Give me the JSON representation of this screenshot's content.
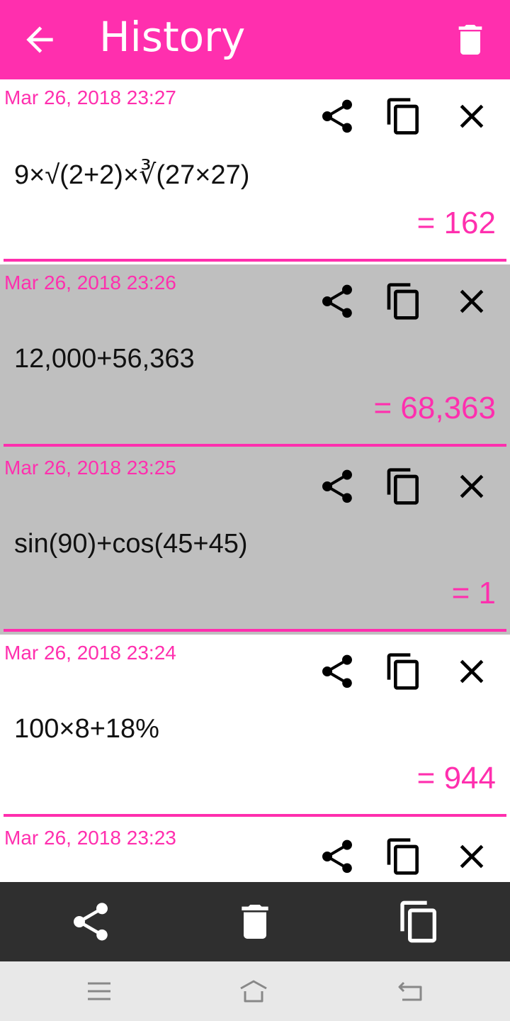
{
  "header": {
    "title": "History",
    "back_icon": "arrow-back-icon",
    "delete_icon": "trash-icon"
  },
  "colors": {
    "accent": "#ff2fae",
    "selected_row": "#bfbfbf",
    "bottom_bar": "#2f2f2f",
    "nav_bar": "#e8e8e8"
  },
  "history": [
    {
      "date": "Mar 26, 2018  23:27",
      "expression": "9×√(2+2)×∛(27×27)",
      "result": "= 162",
      "selected": false
    },
    {
      "date": "Mar 26, 2018  23:26",
      "expression": "12,000+56,363",
      "result": "= 68,363",
      "selected": true
    },
    {
      "date": "Mar 26, 2018  23:25",
      "expression": "sin(90)+cos(45+45)",
      "result": "= 1",
      "selected": true
    },
    {
      "date": "Mar 26, 2018  23:24",
      "expression": "100×8+18%",
      "result": "= 944",
      "selected": false
    },
    {
      "date": "Mar 26, 2018  23:23",
      "expression": "",
      "result": "",
      "selected": false
    }
  ],
  "row_actions": [
    "share-icon",
    "copy-icon",
    "close-icon"
  ],
  "bottom_bar": [
    "share-icon",
    "trash-icon",
    "copy-icon"
  ],
  "system_nav": [
    "menu-icon",
    "home-icon",
    "back-icon"
  ]
}
